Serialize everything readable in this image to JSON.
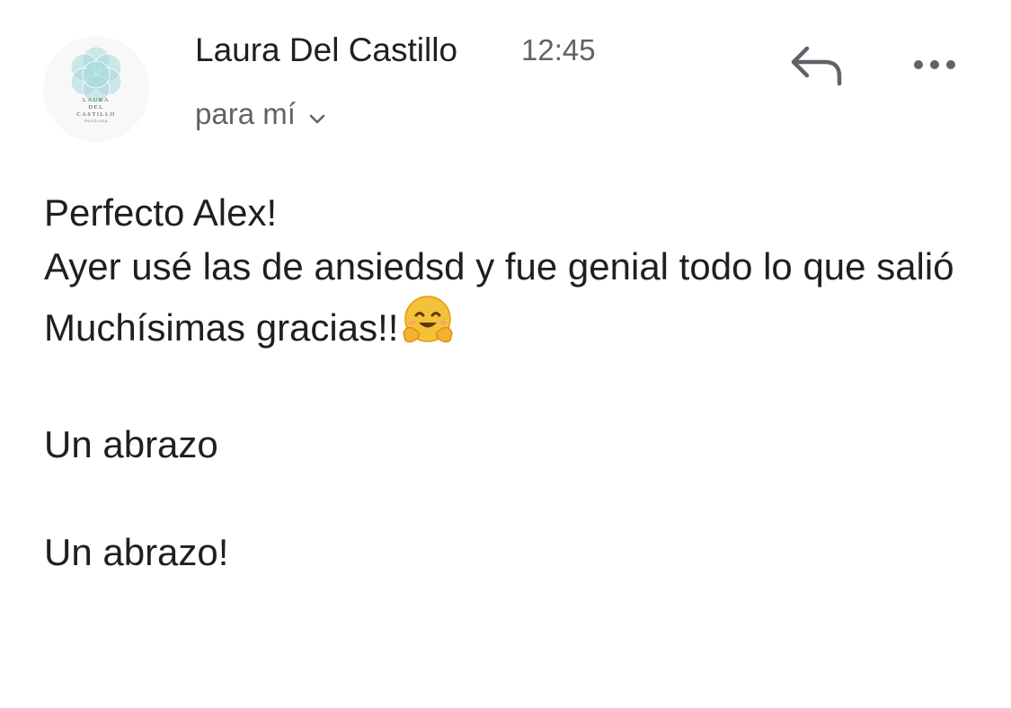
{
  "header": {
    "sender_name": "Laura Del Castillo",
    "time": "12:45",
    "recipient_label": "para mí",
    "avatar": {
      "logo_line1": "LAURA",
      "logo_line2": "DEL",
      "logo_line3": "CASTILLO",
      "logo_line4": "PSICÓLOGA",
      "logo_color": "#a8d8dc"
    }
  },
  "actions": {
    "reply_icon": "reply-arrow-icon",
    "more_icon": "more-horizontal-icon"
  },
  "message": {
    "line1": "Perfecto Alex!",
    "line2": "Ayer usé las de ansiedsd y fue genial todo lo que salió",
    "line3": "Muchísimas gracias!!",
    "line3_emoji": "hugging-face-emoji",
    "line4": "Un abrazo",
    "line5": "Un abrazo!"
  },
  "colors": {
    "text_primary": "#1f1f1f",
    "text_secondary": "#5f6368",
    "icon": "#5f6368"
  }
}
